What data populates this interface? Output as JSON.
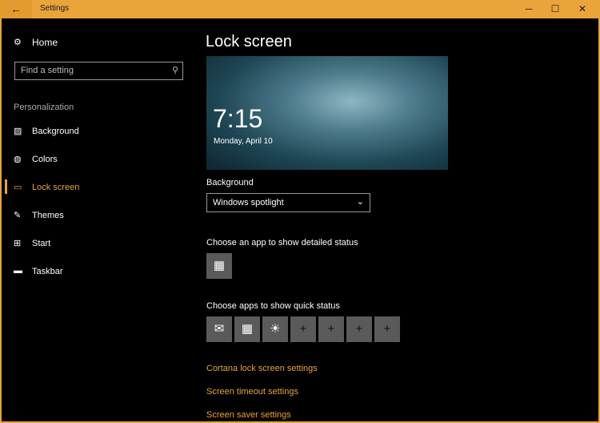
{
  "window": {
    "title": "Settings",
    "accent": "#e8a33a"
  },
  "sidebar": {
    "home": "Home",
    "search_placeholder": "Find a setting",
    "section": "Personalization",
    "items": [
      {
        "label": "Background",
        "icon": "image-icon"
      },
      {
        "label": "Colors",
        "icon": "palette-icon"
      },
      {
        "label": "Lock screen",
        "icon": "lock-screen-icon",
        "active": true
      },
      {
        "label": "Themes",
        "icon": "themes-icon"
      },
      {
        "label": "Start",
        "icon": "start-icon"
      },
      {
        "label": "Taskbar",
        "icon": "taskbar-icon"
      }
    ]
  },
  "main": {
    "title": "Lock screen",
    "preview": {
      "time": "7:15",
      "date": "Monday, April 10"
    },
    "background_label": "Background",
    "background_value": "Windows spotlight",
    "detailed_label": "Choose an app to show detailed status",
    "quick_label": "Choose apps to show quick status",
    "quick_apps": [
      "mail-icon",
      "calendar-icon",
      "weather-icon",
      "plus-icon",
      "plus-icon",
      "plus-icon",
      "plus-icon"
    ],
    "links": [
      "Cortana lock screen settings",
      "Screen timeout settings",
      "Screen saver settings"
    ]
  }
}
